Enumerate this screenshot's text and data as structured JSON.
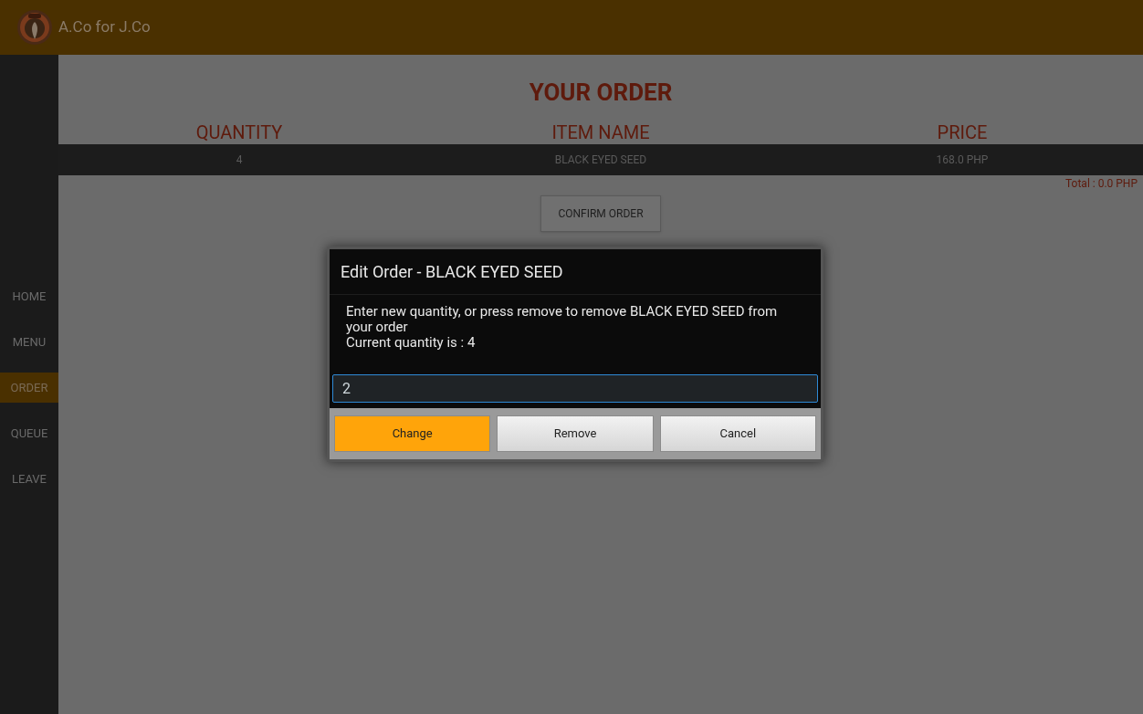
{
  "app_bar": {
    "title": "A.Co for J.Co"
  },
  "sidebar": {
    "items": [
      {
        "label": "HOME",
        "selected": false
      },
      {
        "label": "MENU",
        "selected": false
      },
      {
        "label": "ORDER",
        "selected": true
      },
      {
        "label": "QUEUE",
        "selected": false
      },
      {
        "label": "LEAVE",
        "selected": false
      }
    ]
  },
  "page": {
    "title": "YOUR ORDER",
    "table": {
      "columns": [
        "QUANTITY",
        "ITEM NAME",
        "PRICE"
      ],
      "rows": [
        [
          "4",
          "BLACK EYED SEED",
          "168.0 PHP"
        ]
      ]
    },
    "total": "Total : 0.0 PHP",
    "confirm_button": "CONFIRM ORDER"
  },
  "dialog": {
    "title": "Edit Order - BLACK EYED SEED",
    "message": "Enter new quantity, or press remove to remove BLACK EYED SEED from your order",
    "current": "Current quantity is : 4",
    "input_value": "2",
    "buttons": [
      {
        "label": "Change",
        "kind": "primary"
      },
      {
        "label": "Remove",
        "kind": "normal"
      },
      {
        "label": "Cancel",
        "kind": "normal"
      }
    ]
  }
}
